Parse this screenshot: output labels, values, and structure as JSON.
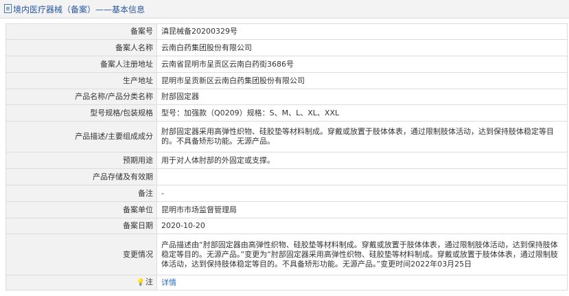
{
  "header": {
    "title": "境内医疗器械（备案）——基本信息",
    "icon": "document-icon"
  },
  "rows": [
    {
      "label": "备案号",
      "value": "滇昆械备20200329号"
    },
    {
      "label": "备案人名称",
      "value": "云南白药集团股份有限公司"
    },
    {
      "label": "备案人注册地址",
      "value": "云南省昆明市呈贡区云南白药街3686号"
    },
    {
      "label": "生产地址",
      "value": "昆明市呈贡新区云南白药集团股份有限公司"
    },
    {
      "label": "产品名称/产品分类名称",
      "value": "肘部固定器"
    },
    {
      "label": "型号规格/包装规格",
      "value": "型号：加强款（Q0209）规格：S、M、L、XL、XXL"
    },
    {
      "label": "产品描述/主要组成成分",
      "value": "肘部固定器采用高弹性织物、硅胶垫等材料制成。穿戴或放置于肢体体表，通过限制肢体活动，达到保持肢体稳定等目的。不具备矫形功能。无源产品。"
    },
    {
      "label": "预期用途",
      "value": "用于对人体肘部的外固定或支撑。"
    },
    {
      "label": "产品存储及有效期",
      "value": ""
    },
    {
      "label": "备注",
      "value": "-"
    },
    {
      "label": "备案单位",
      "value": "昆明市市场监督管理局"
    },
    {
      "label": "备案日期",
      "value": "2020-10-20"
    },
    {
      "label": "变更情况",
      "value": "产品描述由“肘部固定器由高弹性织物、硅胶垫等材料制成。穿戴或放置于肢体体表，通过限制肢体活动，达到保持肢体稳定等目的。无源产品。”变更为“肘部固定器采用高弹性织物、硅胶垫等材料制成。穿戴或放置于肢体体表，通过限制肢体活动，达到保持肢体稳定等目的。不具备矫形功能。无源产品。”变更时间2022年03月25日"
    },
    {
      "label": "注",
      "value": "详情",
      "icon": "lightbulb-icon"
    }
  ]
}
